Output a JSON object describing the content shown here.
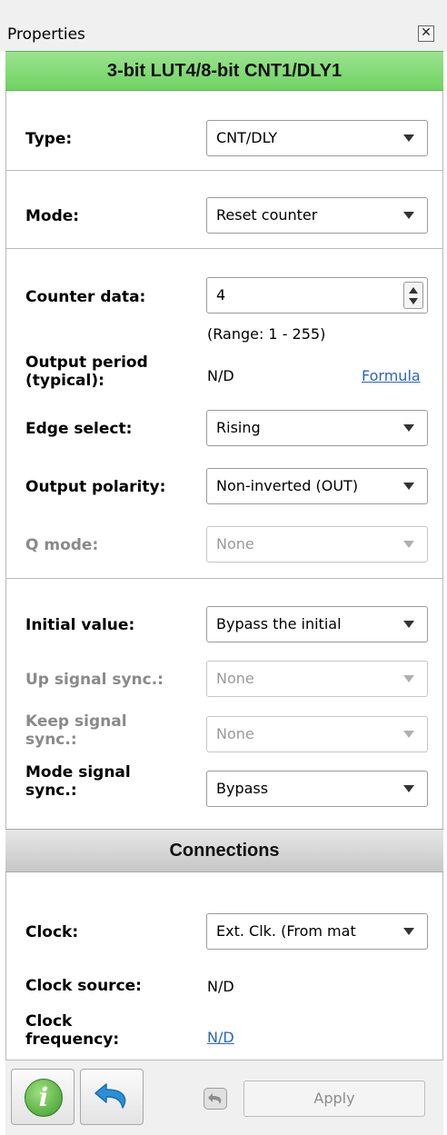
{
  "panel": {
    "title": "Properties",
    "close_symbol": "✕"
  },
  "block_title": "3-bit LUT4/8-bit CNT1/DLY1",
  "fields": {
    "type": {
      "label": "Type:",
      "value": "CNT/DLY"
    },
    "mode": {
      "label": "Mode:",
      "value": "Reset counter"
    },
    "counter_data": {
      "label": "Counter data:",
      "value": "4",
      "range": "(Range:  1 - 255)"
    },
    "output_period": {
      "label_line1": "Output period",
      "label_line2": "(typical):",
      "value": "N/D",
      "link": "Formula"
    },
    "edge_select": {
      "label": "Edge select:",
      "value": "Rising"
    },
    "output_polarity": {
      "label": "Output polarity:",
      "value": "Non-inverted (OUT)"
    },
    "q_mode": {
      "label": "Q mode:",
      "value": "None"
    },
    "initial_value": {
      "label": "Initial value:",
      "value": "Bypass the initial"
    },
    "up_signal_sync": {
      "label": "Up signal sync.:",
      "value": "None"
    },
    "keep_signal_sync": {
      "label_line1": "Keep signal",
      "label_line2": "sync.:",
      "value": "None"
    },
    "mode_signal_sync": {
      "label_line1": "Mode signal",
      "label_line2": "sync.:",
      "value": "Bypass"
    }
  },
  "connections": {
    "header": "Connections",
    "clock": {
      "label": "Clock:",
      "value": "Ext. Clk. (From mat"
    },
    "clock_source": {
      "label": "Clock source:",
      "value": "N/D"
    },
    "clock_frequency": {
      "label_line1": "Clock",
      "label_line2": "frequency:",
      "value": "N/D"
    }
  },
  "footer": {
    "info_glyph": "i",
    "apply_label": "Apply"
  },
  "colors": {
    "header_green": "#6fd262",
    "link_blue": "#2a63c9",
    "info_green": "#3c9a2a",
    "undo_blue": "#2a8fd8"
  }
}
